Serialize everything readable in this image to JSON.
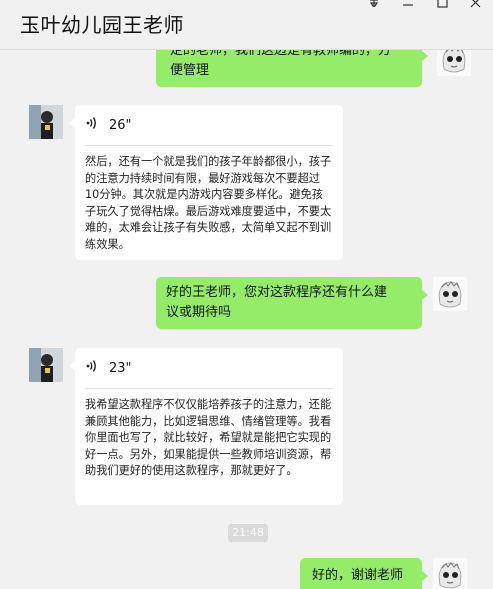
{
  "window": {
    "title": "玉叶幼儿园王老师"
  },
  "messages": {
    "m1": {
      "text_line1": "定的老师，我们这边是有教师编的，方",
      "text_line2": "便管理"
    },
    "m2": {
      "duration": "26\"",
      "transcript": "然后，还有一个就是我们的孩子年龄都很小，孩子的注意力持续时间有限，最好游戏每次不要超过10分钟。其次就是内游戏内容要多样化。避免孩子玩久了觉得枯燥。最后游戏难度要适中，不要太难的，太难会让孩子有失败感，太简单又起不到训练效果。"
    },
    "m3": {
      "text_line1": "好的王老师，您对这款程序还有什么建",
      "text_line2": "议或期待吗"
    },
    "m4": {
      "duration": "23\"",
      "transcript": "我希望这款程序不仅仅能培养孩子的注意力，还能兼顾其他能力，比如逻辑思维、情绪管理等。我看你里面也写了，就比较好，希望就是能把它实现的好一点。另外，如果能提供一些教师培训资源，帮助我们更好的使用这款程序，那就更好了。"
    },
    "timestamp": "21:48",
    "m5": {
      "text": "好的，谢谢老师"
    }
  },
  "icons": {
    "pin": "pin-icon",
    "minimize": "minimize-icon",
    "maximize": "maximize-icon",
    "close": "close-icon",
    "voice": "voice-wave-icon"
  },
  "colors": {
    "self_bubble": "#95ec69",
    "other_bubble": "#ffffff",
    "background": "#f1f1f1"
  }
}
